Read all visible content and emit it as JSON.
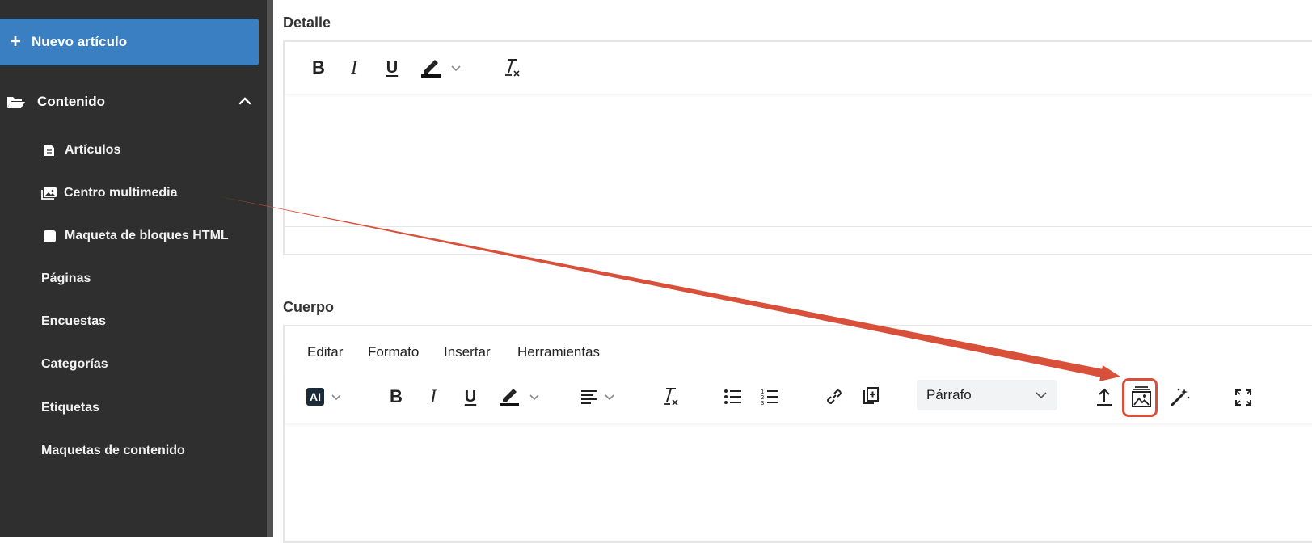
{
  "sidebar": {
    "new_article_label": "Nuevo artículo",
    "section_label": "Contenido",
    "items": [
      {
        "label": "Artículos",
        "icon": "document-icon"
      },
      {
        "label": "Centro multimedia",
        "icon": "images-icon"
      },
      {
        "label": "Maqueta de bloques HTML",
        "icon": "block-icon"
      },
      {
        "label": "Páginas"
      },
      {
        "label": "Encuestas"
      },
      {
        "label": "Categorías"
      },
      {
        "label": "Etiquetas"
      },
      {
        "label": "Maquetas de contenido"
      }
    ]
  },
  "detalle": {
    "label": "Detalle",
    "toolbar": {
      "bold": "B",
      "italic": "I",
      "underline": "U"
    }
  },
  "cuerpo": {
    "label": "Cuerpo",
    "menu": [
      "Editar",
      "Formato",
      "Insertar",
      "Herramientas"
    ],
    "toolbar": {
      "ai": "AI",
      "bold": "B",
      "italic": "I",
      "underline": "U",
      "block_format": "Párrafo"
    }
  },
  "colors": {
    "sidebar_bg": "#2f2f2f",
    "primary_button": "#3a7fc2",
    "annotation": "#d9503a"
  }
}
